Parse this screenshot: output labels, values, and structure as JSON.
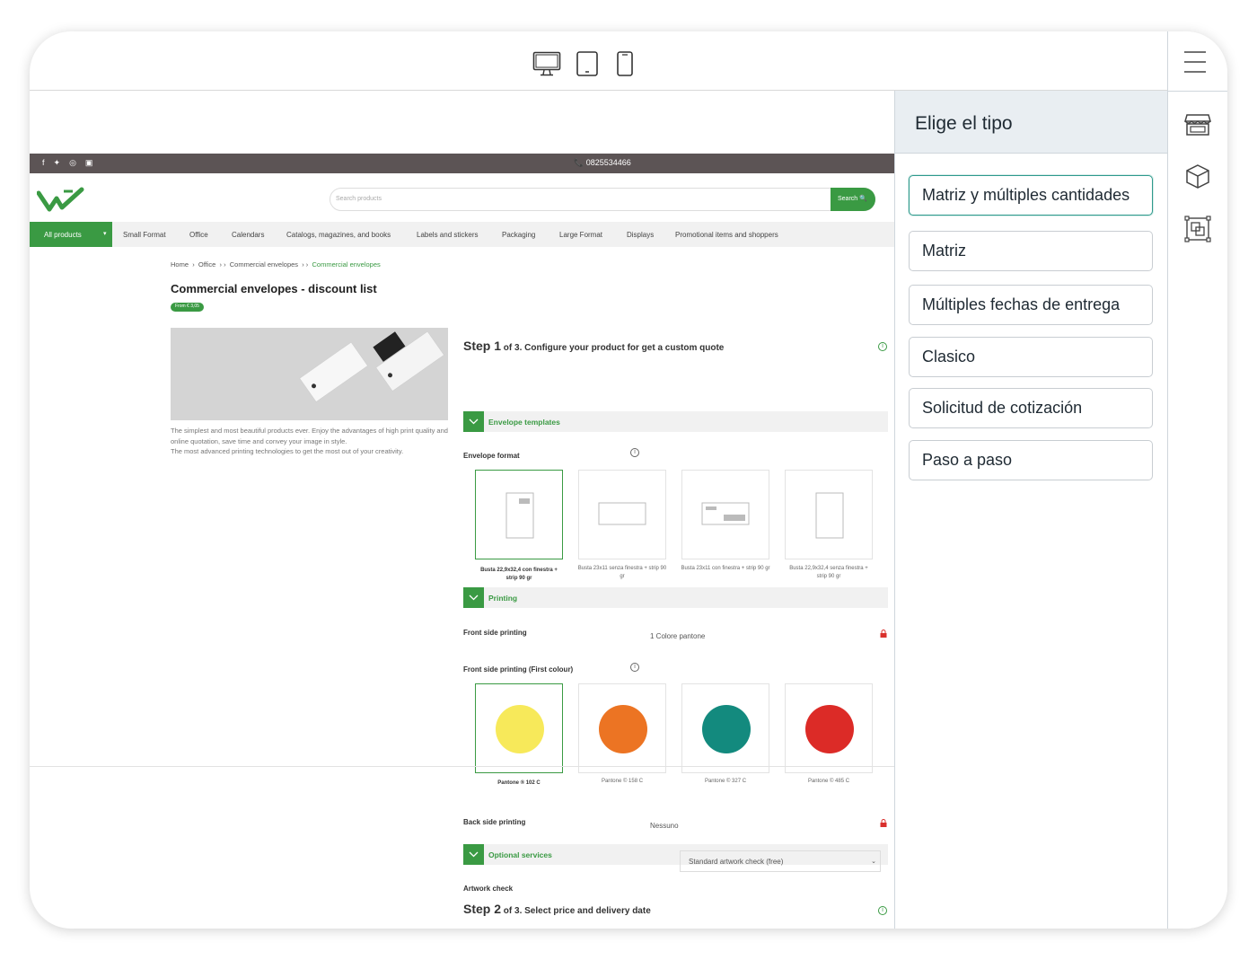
{
  "top": {
    "devices": [
      "desktop-icon",
      "tablet-icon",
      "mobile-icon"
    ]
  },
  "panel": {
    "title": "Elige el tipo",
    "options": [
      "Matriz y múltiples cantidades",
      "Matriz",
      "Múltiples fechas de entrega",
      "Clasico",
      "Solicitud de cotización",
      "Paso a paso"
    ],
    "active_index": 0
  },
  "rail": {
    "icons": [
      "menu-icon",
      "store-icon",
      "box-icon",
      "layers-icon"
    ]
  },
  "site": {
    "phone": "📞 0825534466",
    "search_placeholder": "Search products",
    "search_button": "Search 🔍",
    "nav": {
      "all": "All products",
      "items": [
        "Small Format",
        "Office",
        "Calendars",
        "Catalogs, magazines, and books",
        "Labels and stickers",
        "Packaging",
        "Large Format",
        "Displays",
        "Promotional items and shoppers"
      ]
    },
    "breadcrumb": {
      "home": "Home",
      "sep1": "›",
      "office": "Office",
      "sep2": "› ›",
      "env": "Commercial envelopes",
      "sep3": "› ›",
      "current": "Commercial envelopes"
    },
    "title": "Commercial envelopes - discount list",
    "badge": "From € 3,05",
    "description": "The simplest and most beautiful products ever. Enjoy the advantages of high print quality and online quotation, save time and convey your image in style.\nThe most advanced printing technologies to get the most out of your creativity.",
    "step1": {
      "num": "Step 1",
      "rest": " of 3. Configure your product for get a custom quote"
    },
    "section_templates": "Envelope templates",
    "envelope_format_label": "Envelope format",
    "envelopes": [
      "Busta 22,9x32,4 con finestra + strip 90 gr",
      "Busta 23x11 senza finestra + strip 90 gr",
      "Busta 23x11 con finestra + strip 90 gr",
      "Busta 22,9x32,4 senza finestra + strip 90 gr"
    ],
    "section_printing": "Printing",
    "front_label": "Front side printing",
    "front_value": "1 Colore pantone",
    "front_first_label": "Front side printing (First colour)",
    "colours": [
      {
        "name": "Pantone ® 102 C",
        "hex": "#f7e95a"
      },
      {
        "name": "Pantone © 158 C",
        "hex": "#ec7423"
      },
      {
        "name": "Pantone © 327 C",
        "hex": "#138a7e"
      },
      {
        "name": "Pantone © 485 C",
        "hex": "#dc2b27"
      }
    ],
    "back_label": "Back side printing",
    "back_value": "Nessuno",
    "section_optional": "Optional services",
    "artwork_label": "Artwork check",
    "artwork_value": "Standard artwork check (free)",
    "step2": {
      "num": "Step 2",
      "rest": " of 3. Select price and delivery date"
    }
  }
}
